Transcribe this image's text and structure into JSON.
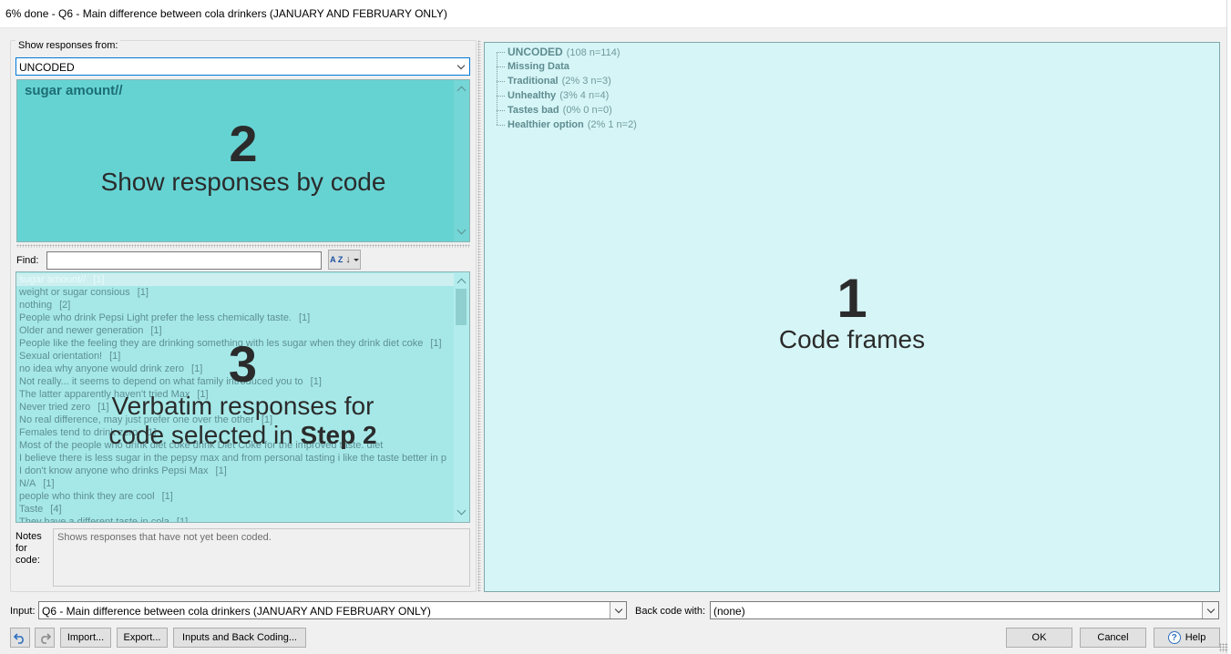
{
  "window": {
    "title": "6% done - Q6 - Main difference between cola drinkers (JANUARY AND FEBRUARY ONLY)"
  },
  "left": {
    "group_label": "Show responses from:",
    "source_combo_value": "UNCODED",
    "step2": {
      "heading": "sugar amount//",
      "number": "2",
      "caption": "Show responses by code"
    },
    "find_label": "Find:",
    "find_value": "",
    "sort_icon_text": "A Z",
    "responses": [
      {
        "text": "sugar amount//",
        "count": "[1]"
      },
      {
        "text": "weight or sugar consious",
        "count": "[1]"
      },
      {
        "text": "nothing",
        "count": "[2]"
      },
      {
        "text": "People who drink Pepsi Light prefer the less chemically taste.",
        "count": "[1]"
      },
      {
        "text": "Older and newer generation",
        "count": "[1]"
      },
      {
        "text": "People like the feeling they are drinking something with les sugar when they drink diet coke",
        "count": "[1]"
      },
      {
        "text": "Sexual orientation!",
        "count": "[1]"
      },
      {
        "text": "no idea why anyone would drink zero",
        "count": "[1]"
      },
      {
        "text": "Not really... it seems to depend on what family introduced you to",
        "count": "[1]"
      },
      {
        "text": "The latter apparently haven't tried Max",
        "count": "[1]"
      },
      {
        "text": "Never tried zero",
        "count": "[1]"
      },
      {
        "text": "No real difference, may just prefer one over the other",
        "count": "[1]"
      },
      {
        "text": "Females tend to drink zero",
        "count": "[1]"
      },
      {
        "text": "Most of the people who drink diet coke drink Diet Coke for the improved taste. diet",
        "count": ""
      },
      {
        "text": "I believe there is less sugar in the pepsy max and from personal tasting i like the taste better in p",
        "count": ""
      },
      {
        "text": "I don't know anyone who drinks Pepsi Max",
        "count": "[1]"
      },
      {
        "text": "N/A",
        "count": "[1]"
      },
      {
        "text": "people who think they are cool",
        "count": "[1]"
      },
      {
        "text": "Taste",
        "count": "[4]"
      },
      {
        "text": "They have a different taste in cola",
        "count": "[1]"
      }
    ],
    "step3": {
      "number": "3",
      "caption_line1": "Verbatim responses for",
      "caption_line2_pre": "code selected in ",
      "caption_line2_bold": "Step 2"
    },
    "notes_label": "Notes for code:",
    "notes_text": "Shows responses that have not yet been coded."
  },
  "right": {
    "tree": [
      {
        "name": "UNCODED",
        "detail": "(108 n=114)"
      },
      {
        "name": "Missing Data",
        "detail": ""
      },
      {
        "name": "Traditional",
        "detail": "(2% 3 n=3)"
      },
      {
        "name": "Unhealthy",
        "detail": "(3% 4 n=4)"
      },
      {
        "name": "Tastes bad",
        "detail": "(0% 0 n=0)"
      },
      {
        "name": "Healthier option",
        "detail": "(2% 1 n=2)"
      }
    ],
    "step1": {
      "number": "1",
      "caption": "Code frames"
    }
  },
  "bottom": {
    "input_label": "Input:",
    "input_value": "Q6 - Main difference between cola drinkers (JANUARY AND FEBRUARY ONLY)",
    "backcode_label": "Back code with:",
    "backcode_value": "(none)",
    "import_label": "Import...",
    "export_label": "Export...",
    "inputs_label": "Inputs and Back Coding...",
    "ok_label": "OK",
    "cancel_label": "Cancel",
    "help_label": "Help",
    "help_icon_glyph": "?"
  },
  "colors": {
    "step2_bg": "#66d3d3",
    "step3_bg": "#a6e8e8",
    "code_frames_bg": "#d6f5f6"
  }
}
